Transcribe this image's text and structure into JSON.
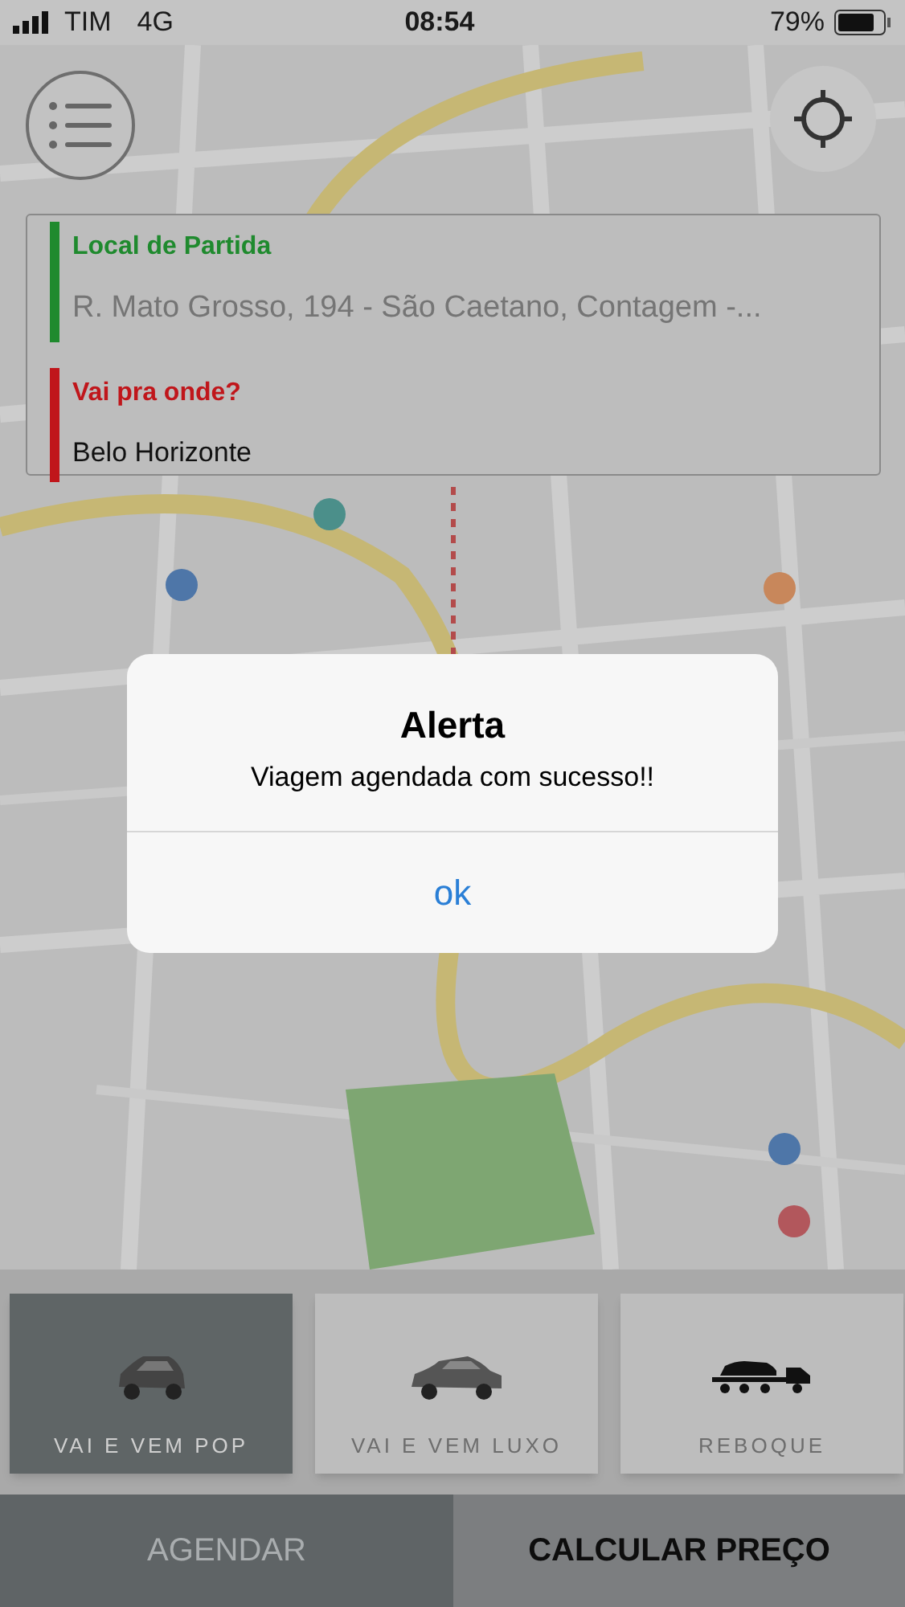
{
  "status_bar": {
    "carrier": "TIM",
    "network": "4G",
    "time": "08:54",
    "battery": "79%"
  },
  "route": {
    "origin": {
      "label": "Local de Partida",
      "value": "R. Mato Grosso, 194 - São Caetano, Contagem -..."
    },
    "destination": {
      "label": "Vai pra onde?",
      "value": "Belo Horizonte"
    }
  },
  "alert": {
    "title": "Alerta",
    "message": "Viagem agendada com sucesso!!",
    "button": "ok"
  },
  "vehicle_options": [
    {
      "kind": "hatch",
      "label": "VAI E VEM POP",
      "selected": true
    },
    {
      "kind": "sedan",
      "label": "VAI E VEM LUXO",
      "selected": false
    },
    {
      "kind": "tow",
      "label": "REBOQUE",
      "selected": false
    }
  ],
  "actions": [
    {
      "label": "AGENDAR",
      "disabled": true
    },
    {
      "label": "CALCULAR PREÇO",
      "disabled": false
    }
  ]
}
